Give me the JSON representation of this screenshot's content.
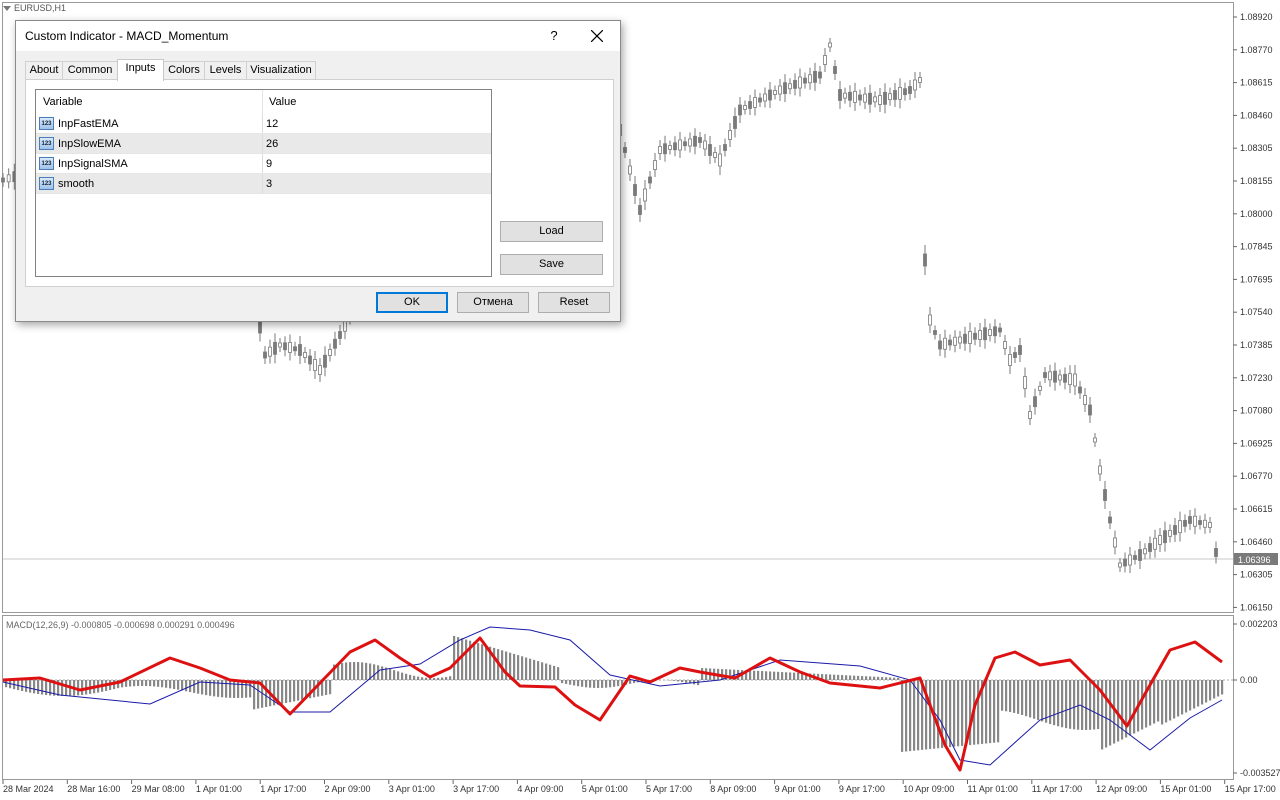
{
  "chart": {
    "symbol": "EURUSD,H1",
    "current_price": "1.06396",
    "price_axis": [
      "1.08920",
      "1.08770",
      "1.08615",
      "1.08460",
      "1.08305",
      "1.08155",
      "1.08000",
      "1.07845",
      "1.07695",
      "1.07540",
      "1.07385",
      "1.07230",
      "1.07080",
      "1.06925",
      "1.06770",
      "1.06615",
      "1.06460",
      "1.06305",
      "1.06150"
    ],
    "macd_axis": [
      "0.002203",
      "0.00",
      "-0.003527"
    ],
    "macd_label": "MACD(12,26,9) -0.000805 -0.000698 0.000291 0.000496",
    "time_axis": [
      "28 Mar 2024",
      "28 Mar 16:00",
      "29 Mar 08:00",
      "1 Apr 01:00",
      "1 Apr 17:00",
      "2 Apr 09:00",
      "3 Apr 01:00",
      "3 Apr 17:00",
      "4 Apr 09:00",
      "5 Apr 01:00",
      "5 Apr 17:00",
      "8 Apr 09:00",
      "9 Apr 01:00",
      "9 Apr 17:00",
      "10 Apr 09:00",
      "11 Apr 01:00",
      "11 Apr 17:00",
      "12 Apr 09:00",
      "15 Apr 01:00",
      "15 Apr 17:00"
    ],
    "colors": {
      "candle": "#7a7a7a",
      "macd_line": "#dd1111",
      "signal_line": "#1a1aa8",
      "histogram": "#888888",
      "grid_line": "#c8c8c8"
    }
  },
  "dialog": {
    "title": "Custom Indicator - MACD_Momentum",
    "help_label": "?",
    "tabs": [
      {
        "label": "About"
      },
      {
        "label": "Common"
      },
      {
        "label": "Inputs"
      },
      {
        "label": "Colors"
      },
      {
        "label": "Levels"
      },
      {
        "label": "Visualization"
      }
    ],
    "active_tab": "Inputs",
    "grid": {
      "headers": {
        "variable": "Variable",
        "value": "Value"
      },
      "rows": [
        {
          "name": "InpFastEMA",
          "value": "12"
        },
        {
          "name": "InpSlowEMA",
          "value": "26"
        },
        {
          "name": "InpSignalSMA",
          "value": "9"
        },
        {
          "name": "smooth",
          "value": "3"
        }
      ],
      "icon_text": "123"
    },
    "buttons": {
      "load": "Load",
      "save": "Save",
      "ok": "OK",
      "cancel": "Отмена",
      "reset": "Reset"
    }
  }
}
